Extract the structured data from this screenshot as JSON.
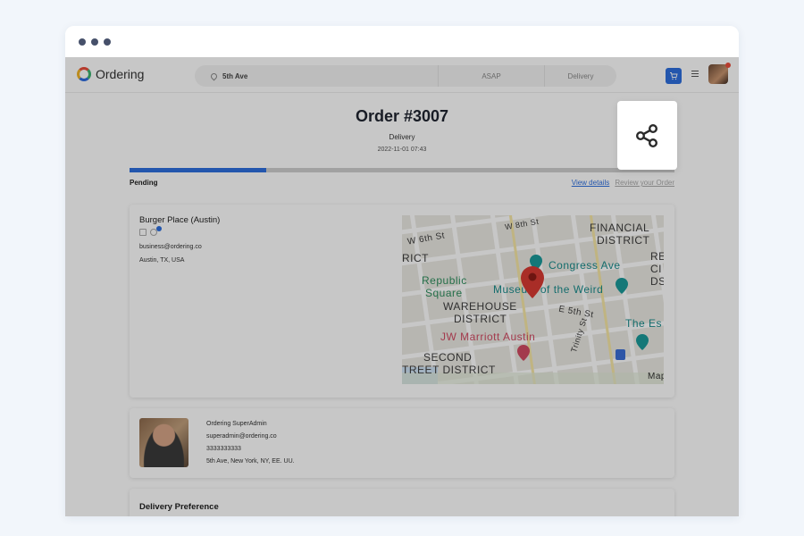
{
  "header": {
    "logo_text": "Ordering",
    "address": "5th Ave",
    "time": "ASAP",
    "order_type": "Delivery"
  },
  "order": {
    "title": "Order #3007",
    "type": "Delivery",
    "date": "2022-11-01 07:43",
    "status": "Pending",
    "progress": 0.25,
    "view_details": "View details",
    "review_order": "Review your Order"
  },
  "business": {
    "name": "Burger Place (Austin)",
    "email": "business@ordering.co",
    "address": "Austin, TX, USA",
    "badge_count": "1"
  },
  "map": {
    "labels": {
      "w8th": "W 8th St",
      "financial1": "FINANCIAL",
      "financial2": "DISTRICT",
      "w6th": "W 6th St",
      "rict": "RICT",
      "congress": "Congress Ave",
      "re": "RE",
      "cl": "CI",
      "ds": "DS",
      "republic1": "Republic",
      "republic2": "Square",
      "museum": "Museum of the Weird",
      "warehouse1": "WAREHOUSE",
      "warehouse2": "DISTRICT",
      "e5th": "E 5th St",
      "theesc": "The Es",
      "jw": "JW Marriott Austin",
      "second1": "SECOND",
      "second2": "TREET DISTRICT",
      "trinity": "Trinity St",
      "map": "Map"
    }
  },
  "customer": {
    "name": "Ordering SuperAdmin",
    "email": "superadmin@ordering.co",
    "phone": "3333333333",
    "address": "5th Ave, New York, NY, EE. UU."
  },
  "delivery": {
    "title": "Delivery Preference"
  },
  "colors": {
    "accent": "#2e6fde",
    "pin": "#d93a32"
  }
}
